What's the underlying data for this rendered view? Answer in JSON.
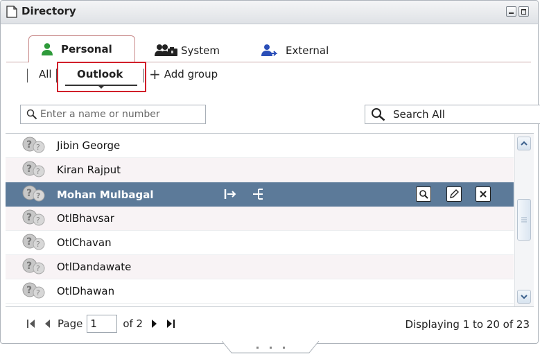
{
  "window": {
    "title": "Directory"
  },
  "tabs": [
    {
      "label": "Personal",
      "icon": "person-green-icon",
      "active": true
    },
    {
      "label": "System",
      "icon": "people-folder-icon",
      "active": false
    },
    {
      "label": "External",
      "icon": "person-arrow-icon",
      "active": false
    },
    {
      "label": "Search All",
      "icon": "search-icon",
      "active": false
    }
  ],
  "subnav": {
    "all_label": "All",
    "outlook_label": "Outlook",
    "add_group_label": "Add group"
  },
  "search": {
    "placeholder": "Enter a name or number",
    "value": ""
  },
  "contacts": [
    {
      "name": "Jibin George",
      "selected": false
    },
    {
      "name": "Kiran Rajput",
      "selected": false
    },
    {
      "name": "Mohan Mulbagal",
      "selected": true
    },
    {
      "name": "OtlBhavsar",
      "selected": false
    },
    {
      "name": "OtlChavan",
      "selected": false
    },
    {
      "name": "OtlDandawate",
      "selected": false
    },
    {
      "name": "OtlDhawan",
      "selected": false
    }
  ],
  "row_actions": [
    "transfer-icon",
    "conference-icon",
    "view-details-icon",
    "edit-icon",
    "delete-icon"
  ],
  "pager": {
    "page_label": "Page",
    "current_page": "1",
    "of_label": "of 2",
    "displaying": "Displaying 1 to 20 of 23"
  },
  "colors": {
    "selected_row": "#5c7a99",
    "highlight_box": "#d11f2a",
    "personal_icon": "#2e9a3a",
    "external_icon": "#2b4fb8"
  }
}
